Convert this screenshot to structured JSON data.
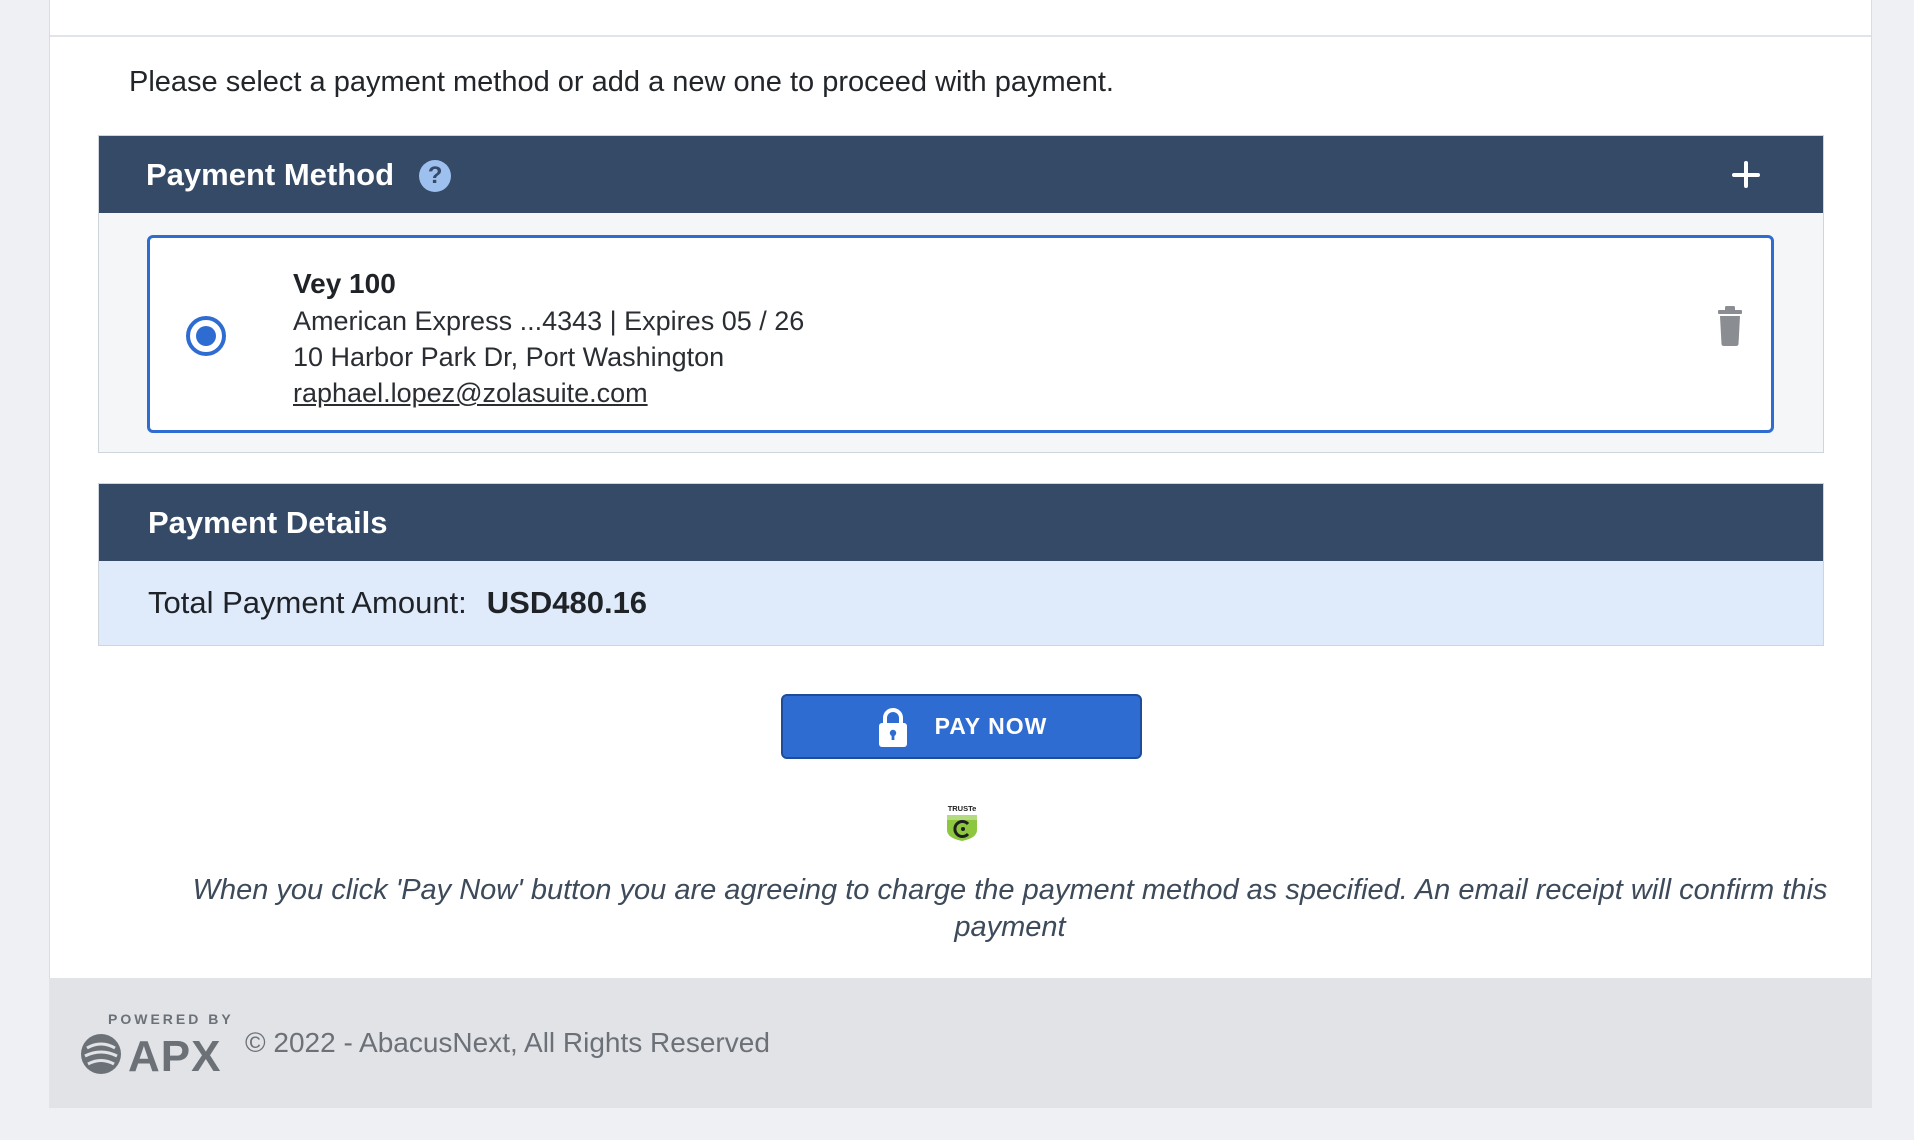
{
  "intro_text": "Please select a payment method or add a new one to proceed with payment.",
  "payment_method": {
    "title": "Payment Method",
    "help_glyph": "?",
    "add_icon": "plus-icon",
    "selected_method": {
      "name": "Vey 100",
      "card_line": "American Express ...4343 | Expires 05 / 26",
      "address": "10 Harbor Park Dr, Port Washington",
      "email": "raphael.lopez@zolasuite.com",
      "selected": true
    }
  },
  "payment_details": {
    "title": "Payment Details",
    "total_label": "Total Payment Amount:",
    "total_value": "USD480.16"
  },
  "pay_button": {
    "label": "PAY NOW",
    "icon": "lock-icon"
  },
  "trust_badge": {
    "text": "TRUSTe"
  },
  "disclaimer": "When you click 'Pay Now' button you are agreeing to charge the payment method as specified. An email receipt will confirm this payment",
  "footer": {
    "powered_by": "POWERED BY",
    "logo_text": "APX",
    "copyright": "© 2022 - AbacusNext, All Rights Reserved"
  },
  "colors": {
    "header_bg": "#354a67",
    "accent": "#2f6cd1",
    "amount_bg": "#dfeafb",
    "footer_bg": "#e1e3e7"
  }
}
